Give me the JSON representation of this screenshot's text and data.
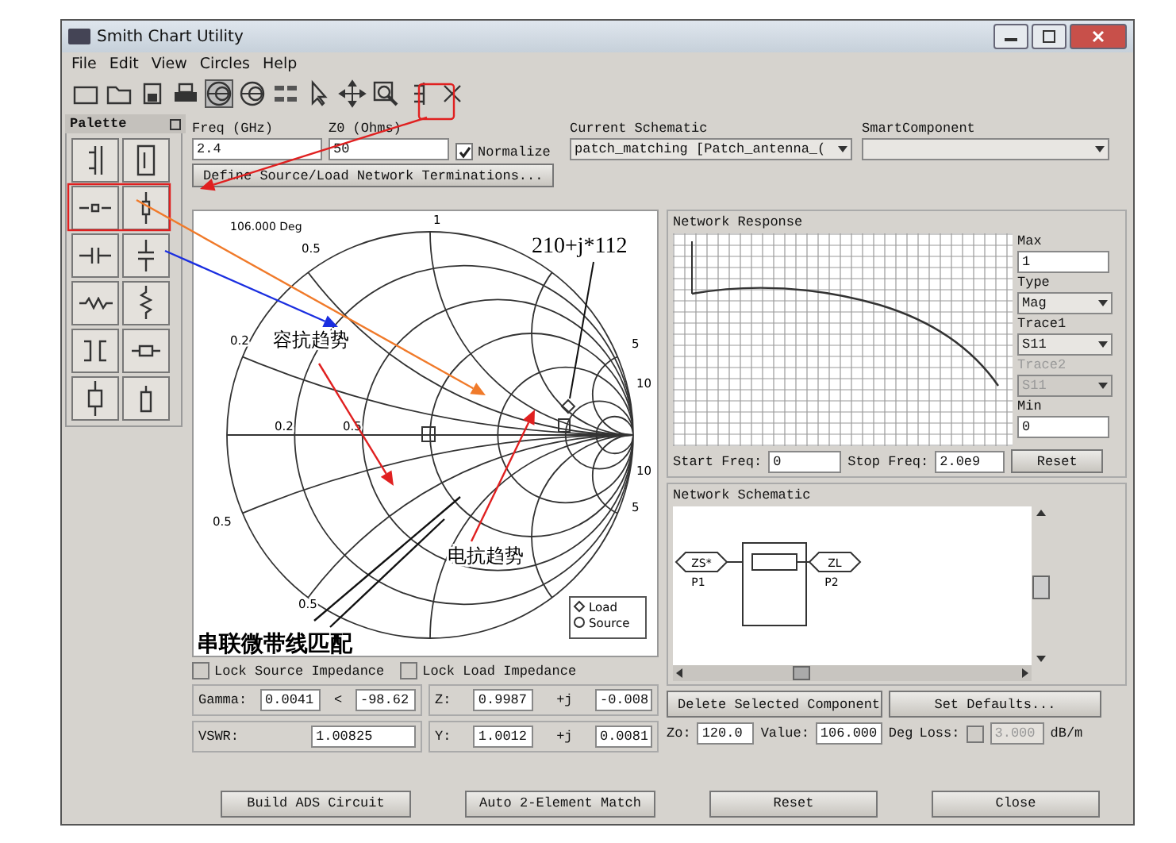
{
  "window": {
    "title": "Smith Chart Utility"
  },
  "menu": [
    {
      "label": "File"
    },
    {
      "label": "Edit"
    },
    {
      "label": "View"
    },
    {
      "label": "Circles"
    },
    {
      "label": "Help"
    }
  ],
  "palette": {
    "title": "Palette"
  },
  "freq": {
    "label": "Freq (GHz)",
    "value": "2.4"
  },
  "z0": {
    "label": "Z0 (Ohms)",
    "value": "50"
  },
  "normalize": {
    "label": "Normalize",
    "checked": true
  },
  "define_button": "Define Source/Load Network Terminations...",
  "current_schematic": {
    "label": "Current Schematic",
    "value": "patch_matching [Patch_antenna_("
  },
  "smart_component": {
    "label": "SmartComponent"
  },
  "smith_chart": {
    "angle_label": "106.000 Deg",
    "labels": [
      "1",
      "0.5",
      "0.2",
      "0.2",
      "0.5",
      "5",
      "10",
      "10",
      "5",
      "0.5",
      "0.5"
    ],
    "legend": [
      {
        "label": "Load",
        "kind": "diamond"
      },
      {
        "label": "Source",
        "kind": "circle"
      }
    ],
    "annotations": [
      {
        "kind": "impedance",
        "text": "210+j*112"
      },
      {
        "kind": "trend",
        "text": "容抗趋势"
      },
      {
        "kind": "trend2",
        "text": "电抗趋势"
      },
      {
        "kind": "caption",
        "text": "串联微带线匹配"
      }
    ]
  },
  "network_response": {
    "title": "Network Response",
    "max": {
      "label": "Max",
      "value": "1"
    },
    "type": {
      "label": "Type",
      "value": "Mag"
    },
    "trace1": {
      "label": "Trace1",
      "value": "S11",
      "disabled": false
    },
    "trace2": {
      "label": "Trace2",
      "value": "S11",
      "disabled": true
    },
    "min": {
      "label": "Min",
      "value": "0"
    },
    "start_freq": {
      "label": "Start Freq:",
      "value": "0"
    },
    "stop_freq": {
      "label": "Stop Freq:",
      "value": "2.0e9"
    },
    "reset": "Reset"
  },
  "network_schematic": {
    "title": "Network Schematic",
    "ports": [
      {
        "label": "ZS*",
        "name": "P1"
      },
      {
        "label": "ZL",
        "name": "P2"
      }
    ]
  },
  "schematic_buttons": [
    "Delete Selected Component",
    "Set Defaults..."
  ],
  "component": {
    "zo_label": "Zo:",
    "zo": "120.0",
    "value_label": "Value:",
    "value": "106.000",
    "unit": "Deg",
    "loss_label": "Loss:",
    "loss_checked": false,
    "loss": "3.000",
    "loss_unit": "dB/m"
  },
  "lock_source": {
    "label": "Lock Source Impedance",
    "checked": false
  },
  "lock_load": {
    "label": "Lock Load Impedance",
    "checked": false
  },
  "gamma": {
    "label": "Gamma:",
    "mag": "0.0041",
    "sign": "<",
    "angle": "-98.62"
  },
  "z": {
    "label": "Z:",
    "re": "0.9987",
    "j": "+j",
    "im": "-0.008"
  },
  "vswr": {
    "label": "VSWR:",
    "value": "1.00825"
  },
  "y": {
    "label": "Y:",
    "re": "1.0012",
    "j": "+j",
    "im": "0.0081"
  },
  "bottom_buttons": [
    "Build ADS Circuit",
    "Auto 2-Element Match",
    "Reset",
    "Close"
  ]
}
